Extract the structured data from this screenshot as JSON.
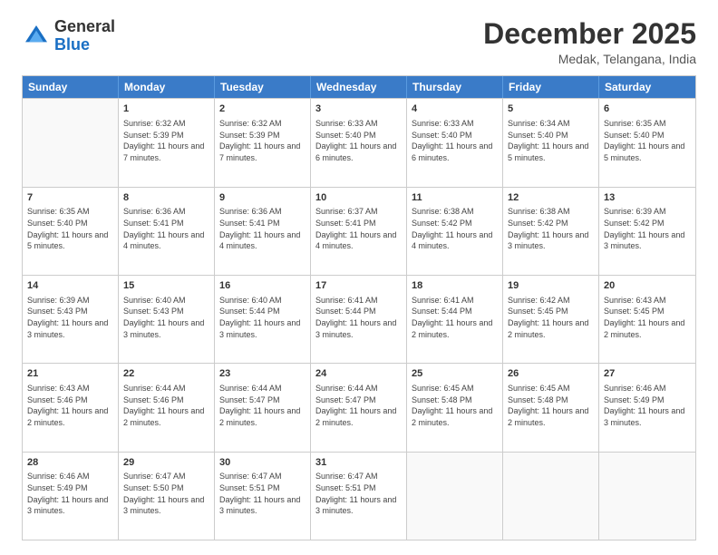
{
  "header": {
    "logo": {
      "general": "General",
      "blue": "Blue"
    },
    "title": "December 2025",
    "location": "Medak, Telangana, India"
  },
  "days": [
    "Sunday",
    "Monday",
    "Tuesday",
    "Wednesday",
    "Thursday",
    "Friday",
    "Saturday"
  ],
  "weeks": [
    [
      {
        "day": "",
        "empty": true
      },
      {
        "day": "1",
        "sunrise": "Sunrise: 6:32 AM",
        "sunset": "Sunset: 5:39 PM",
        "daylight": "Daylight: 11 hours and 7 minutes."
      },
      {
        "day": "2",
        "sunrise": "Sunrise: 6:32 AM",
        "sunset": "Sunset: 5:39 PM",
        "daylight": "Daylight: 11 hours and 7 minutes."
      },
      {
        "day": "3",
        "sunrise": "Sunrise: 6:33 AM",
        "sunset": "Sunset: 5:40 PM",
        "daylight": "Daylight: 11 hours and 6 minutes."
      },
      {
        "day": "4",
        "sunrise": "Sunrise: 6:33 AM",
        "sunset": "Sunset: 5:40 PM",
        "daylight": "Daylight: 11 hours and 6 minutes."
      },
      {
        "day": "5",
        "sunrise": "Sunrise: 6:34 AM",
        "sunset": "Sunset: 5:40 PM",
        "daylight": "Daylight: 11 hours and 5 minutes."
      },
      {
        "day": "6",
        "sunrise": "Sunrise: 6:35 AM",
        "sunset": "Sunset: 5:40 PM",
        "daylight": "Daylight: 11 hours and 5 minutes."
      }
    ],
    [
      {
        "day": "7",
        "sunrise": "Sunrise: 6:35 AM",
        "sunset": "Sunset: 5:40 PM",
        "daylight": "Daylight: 11 hours and 5 minutes."
      },
      {
        "day": "8",
        "sunrise": "Sunrise: 6:36 AM",
        "sunset": "Sunset: 5:41 PM",
        "daylight": "Daylight: 11 hours and 4 minutes."
      },
      {
        "day": "9",
        "sunrise": "Sunrise: 6:36 AM",
        "sunset": "Sunset: 5:41 PM",
        "daylight": "Daylight: 11 hours and 4 minutes."
      },
      {
        "day": "10",
        "sunrise": "Sunrise: 6:37 AM",
        "sunset": "Sunset: 5:41 PM",
        "daylight": "Daylight: 11 hours and 4 minutes."
      },
      {
        "day": "11",
        "sunrise": "Sunrise: 6:38 AM",
        "sunset": "Sunset: 5:42 PM",
        "daylight": "Daylight: 11 hours and 4 minutes."
      },
      {
        "day": "12",
        "sunrise": "Sunrise: 6:38 AM",
        "sunset": "Sunset: 5:42 PM",
        "daylight": "Daylight: 11 hours and 3 minutes."
      },
      {
        "day": "13",
        "sunrise": "Sunrise: 6:39 AM",
        "sunset": "Sunset: 5:42 PM",
        "daylight": "Daylight: 11 hours and 3 minutes."
      }
    ],
    [
      {
        "day": "14",
        "sunrise": "Sunrise: 6:39 AM",
        "sunset": "Sunset: 5:43 PM",
        "daylight": "Daylight: 11 hours and 3 minutes."
      },
      {
        "day": "15",
        "sunrise": "Sunrise: 6:40 AM",
        "sunset": "Sunset: 5:43 PM",
        "daylight": "Daylight: 11 hours and 3 minutes."
      },
      {
        "day": "16",
        "sunrise": "Sunrise: 6:40 AM",
        "sunset": "Sunset: 5:44 PM",
        "daylight": "Daylight: 11 hours and 3 minutes."
      },
      {
        "day": "17",
        "sunrise": "Sunrise: 6:41 AM",
        "sunset": "Sunset: 5:44 PM",
        "daylight": "Daylight: 11 hours and 3 minutes."
      },
      {
        "day": "18",
        "sunrise": "Sunrise: 6:41 AM",
        "sunset": "Sunset: 5:44 PM",
        "daylight": "Daylight: 11 hours and 2 minutes."
      },
      {
        "day": "19",
        "sunrise": "Sunrise: 6:42 AM",
        "sunset": "Sunset: 5:45 PM",
        "daylight": "Daylight: 11 hours and 2 minutes."
      },
      {
        "day": "20",
        "sunrise": "Sunrise: 6:43 AM",
        "sunset": "Sunset: 5:45 PM",
        "daylight": "Daylight: 11 hours and 2 minutes."
      }
    ],
    [
      {
        "day": "21",
        "sunrise": "Sunrise: 6:43 AM",
        "sunset": "Sunset: 5:46 PM",
        "daylight": "Daylight: 11 hours and 2 minutes."
      },
      {
        "day": "22",
        "sunrise": "Sunrise: 6:44 AM",
        "sunset": "Sunset: 5:46 PM",
        "daylight": "Daylight: 11 hours and 2 minutes."
      },
      {
        "day": "23",
        "sunrise": "Sunrise: 6:44 AM",
        "sunset": "Sunset: 5:47 PM",
        "daylight": "Daylight: 11 hours and 2 minutes."
      },
      {
        "day": "24",
        "sunrise": "Sunrise: 6:44 AM",
        "sunset": "Sunset: 5:47 PM",
        "daylight": "Daylight: 11 hours and 2 minutes."
      },
      {
        "day": "25",
        "sunrise": "Sunrise: 6:45 AM",
        "sunset": "Sunset: 5:48 PM",
        "daylight": "Daylight: 11 hours and 2 minutes."
      },
      {
        "day": "26",
        "sunrise": "Sunrise: 6:45 AM",
        "sunset": "Sunset: 5:48 PM",
        "daylight": "Daylight: 11 hours and 2 minutes."
      },
      {
        "day": "27",
        "sunrise": "Sunrise: 6:46 AM",
        "sunset": "Sunset: 5:49 PM",
        "daylight": "Daylight: 11 hours and 3 minutes."
      }
    ],
    [
      {
        "day": "28",
        "sunrise": "Sunrise: 6:46 AM",
        "sunset": "Sunset: 5:49 PM",
        "daylight": "Daylight: 11 hours and 3 minutes."
      },
      {
        "day": "29",
        "sunrise": "Sunrise: 6:47 AM",
        "sunset": "Sunset: 5:50 PM",
        "daylight": "Daylight: 11 hours and 3 minutes."
      },
      {
        "day": "30",
        "sunrise": "Sunrise: 6:47 AM",
        "sunset": "Sunset: 5:51 PM",
        "daylight": "Daylight: 11 hours and 3 minutes."
      },
      {
        "day": "31",
        "sunrise": "Sunrise: 6:47 AM",
        "sunset": "Sunset: 5:51 PM",
        "daylight": "Daylight: 11 hours and 3 minutes."
      },
      {
        "day": "",
        "empty": true
      },
      {
        "day": "",
        "empty": true
      },
      {
        "day": "",
        "empty": true
      }
    ]
  ]
}
